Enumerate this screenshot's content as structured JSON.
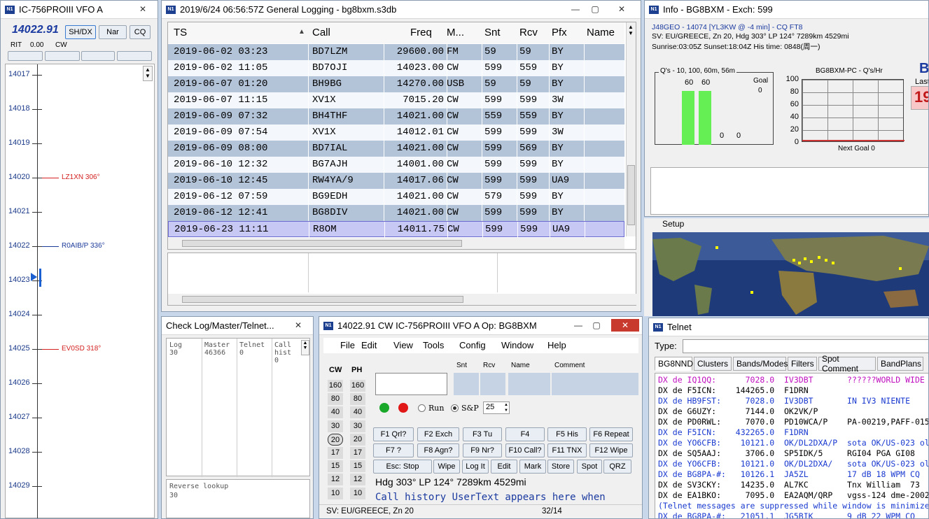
{
  "vfo": {
    "title": "IC-756PROIII VFO A",
    "freq": "14022.91",
    "btns": [
      "SH/DX",
      "Nar",
      "CQ"
    ],
    "rit": "RIT",
    "rit_val": "0.00",
    "cw": "CW",
    "ticks": [
      "14017",
      "14018",
      "14019",
      "14020",
      "14021",
      "14022",
      "14023",
      "14024",
      "14025",
      "14026",
      "14027",
      "14028",
      "14029"
    ],
    "spots": [
      {
        "call": "LZ1XN 306°",
        "color": "#d42020",
        "tick": 3
      },
      {
        "call": "R0AIB/P 336°",
        "color": "#1b3a9a",
        "tick": 5
      },
      {
        "call": "EV0SD 318°",
        "color": "#d42020",
        "tick": 8
      }
    ]
  },
  "log": {
    "title": "2019/6/24 06:56:57Z  General Logging - bg8bxm.s3db",
    "headers": [
      "TS",
      "Call",
      "Freq",
      "M...",
      "Snt",
      "Rcv",
      "Pfx",
      "Name"
    ],
    "rows": [
      [
        "2019-06-02 03:23",
        "BD7LZM",
        "29600.00",
        "FM",
        "59",
        "59",
        "BY"
      ],
      [
        "2019-06-02 11:05",
        "BD7OJI",
        "14023.00",
        "CW",
        "599",
        "559",
        "BY"
      ],
      [
        "2019-06-07 01:20",
        "BH9BG",
        "14270.00",
        "USB",
        "59",
        "59",
        "BY"
      ],
      [
        "2019-06-07 11:15",
        "XV1X",
        "7015.20",
        "CW",
        "599",
        "599",
        "3W"
      ],
      [
        "2019-06-09 07:32",
        "BH4THF",
        "14021.00",
        "CW",
        "559",
        "559",
        "BY"
      ],
      [
        "2019-06-09 07:54",
        "XV1X",
        "14012.01",
        "CW",
        "599",
        "599",
        "3W"
      ],
      [
        "2019-06-09 08:00",
        "BD7IAL",
        "14021.00",
        "CW",
        "599",
        "569",
        "BY"
      ],
      [
        "2019-06-10 12:32",
        "BG7AJH",
        "14001.00",
        "CW",
        "599",
        "599",
        "BY"
      ],
      [
        "2019-06-10 12:45",
        "RW4YA/9",
        "14017.06",
        "CW",
        "599",
        "599",
        "UA9"
      ],
      [
        "2019-06-12 07:59",
        "BG9EDH",
        "14021.00",
        "CW",
        "579",
        "599",
        "BY"
      ],
      [
        "2019-06-12 12:41",
        "BG8DIV",
        "14021.00",
        "CW",
        "599",
        "599",
        "BY"
      ],
      [
        "2019-06-23 11:11",
        "R8OM",
        "14011.75",
        "CW",
        "599",
        "599",
        "UA9"
      ]
    ]
  },
  "info": {
    "title": "Info - BG8BXM - Exch: 599",
    "line1": "J48GEO - 14074 [YL3KW @ -4 min] - CQ FT8",
    "line2": "SV: EU/GREECE, Zn 20, Hdg 303° LP 124° 7289km 4529mi",
    "line3": "Sunrise:03:05Z Sunset:18:04Z His time: 0848(周一)",
    "qs_title": "Q's - 10, 100, 60m, 56m",
    "goal_lbl": "Goal",
    "goal_val": "0",
    "bars": [
      "60",
      "60",
      "0",
      "0"
    ],
    "rate_title": "BG8BXM-PC - Q's/Hr",
    "rate_y": [
      "100",
      "80",
      "60",
      "40",
      "20",
      "0"
    ],
    "next_goal": "Next Goal 0",
    "last": "Last",
    "big": "19",
    "b": "B",
    "setup": "Setup"
  },
  "check": {
    "title": "Check Log/Master/Telnet...",
    "cols": [
      {
        "h": "Log",
        "v": "30"
      },
      {
        "h": "Master",
        "v": "46366"
      },
      {
        "h": "Telnet",
        "v": "0"
      },
      {
        "h": "Call hist",
        "v": "0"
      }
    ],
    "rev": "Reverse lookup",
    "rev_v": "30"
  },
  "entry": {
    "title": "14022.91 CW IC-756PROIII VFO A   Op: BG8BXM",
    "menu": [
      "File",
      "Edit",
      "View",
      "Tools",
      "Config",
      "Window",
      "Help"
    ],
    "cw": "CW",
    "ph": "PH",
    "cwv": [
      "160",
      "80",
      "40",
      "30",
      "20",
      "17",
      "15",
      "12",
      "10"
    ],
    "phv": [
      "160",
      "80",
      "40",
      "30",
      "20",
      "17",
      "15",
      "12",
      "10"
    ],
    "lbls": [
      "Snt",
      "Rcv",
      "Name",
      "Comment"
    ],
    "run": "Run",
    "sp": "S&P",
    "spin": "25",
    "fkeys": [
      "F1 Qrl?",
      "F2 Exch",
      "F3 Tu",
      "F4",
      "F5 His",
      "F6 Repeat",
      "F7 ?",
      "F8 Agn?",
      "F9 Nr?",
      "F10 Call?",
      "F11 TNX",
      "F12 Wipe"
    ],
    "acts": [
      "Esc: Stop",
      "Wipe",
      "Log It",
      "Edit",
      "Mark",
      "Store",
      "Spot",
      "QRZ"
    ],
    "hdg": "Hdg 303° LP 124° 7289km 4529mi",
    "hist": "Call history UserText appears here when",
    "status": "SV: EU/GREECE, Zn 20",
    "count": "32/14"
  },
  "telnet": {
    "title": "Telnet",
    "type": "Type:",
    "tabs": [
      "BG8NND",
      "Clusters",
      "Bands/Modes",
      "Filters",
      "Spot Comment",
      "BandPlans"
    ],
    "lines": [
      {
        "t": "DX de IQ1QQ:      7028.0  IV3DBT       ??????WORLD WIDE",
        "c": "#c010c0"
      },
      {
        "t": "DX de F5ICN:    144265.0  F1DRN",
        "c": "#000"
      },
      {
        "t": "DX de HB9FST:     7028.0  IV3DBT       IN IV3 NIENTE",
        "c": "#1a3ad0"
      },
      {
        "t": "DX de G6UZY:      7144.0  OK2VK/P",
        "c": "#000"
      },
      {
        "t": "DX de PD0RWL:     7070.0  PD10WCA/P    PA-00219,PAFF-015",
        "c": "#000"
      },
      {
        "t": "DX de F5ICN:    432265.0  F1DRN",
        "c": "#1a3ad0"
      },
      {
        "t": "DX de YO6CFB:    10121.0  OK/DL2DXA/P  sota OK/US-023 ol",
        "c": "#1a3ad0"
      },
      {
        "t": "DX de SQ5AAJ:     3706.0  SP5IDK/5     RGI04 PGA GI08",
        "c": "#000"
      },
      {
        "t": "DX de YO6CFB:    10121.0  OK/DL2DXA/   sota OK/US-023 ol",
        "c": "#1a3ad0"
      },
      {
        "t": "DX de BG8PA-#:   10126.1  JA5ZL        17 dB 18 WPM CQ",
        "c": "#1a3ad0"
      },
      {
        "t": "DX de SV3CKY:    14235.0  AL7KC        Tnx William  73",
        "c": "#000"
      },
      {
        "t": "DX de EA1BKO:     7095.0  EA2AQM/QRP   vgss-124 dme-2002",
        "c": "#000"
      },
      {
        "t": "(Telnet messages are suppressed while window is minimize",
        "c": "#1a3ad0"
      },
      {
        "t": "DX de BG8PA-#:   21051.1  JG5BIK       9 dB 22 WPM CQ",
        "c": "#1a3ad0"
      }
    ]
  }
}
